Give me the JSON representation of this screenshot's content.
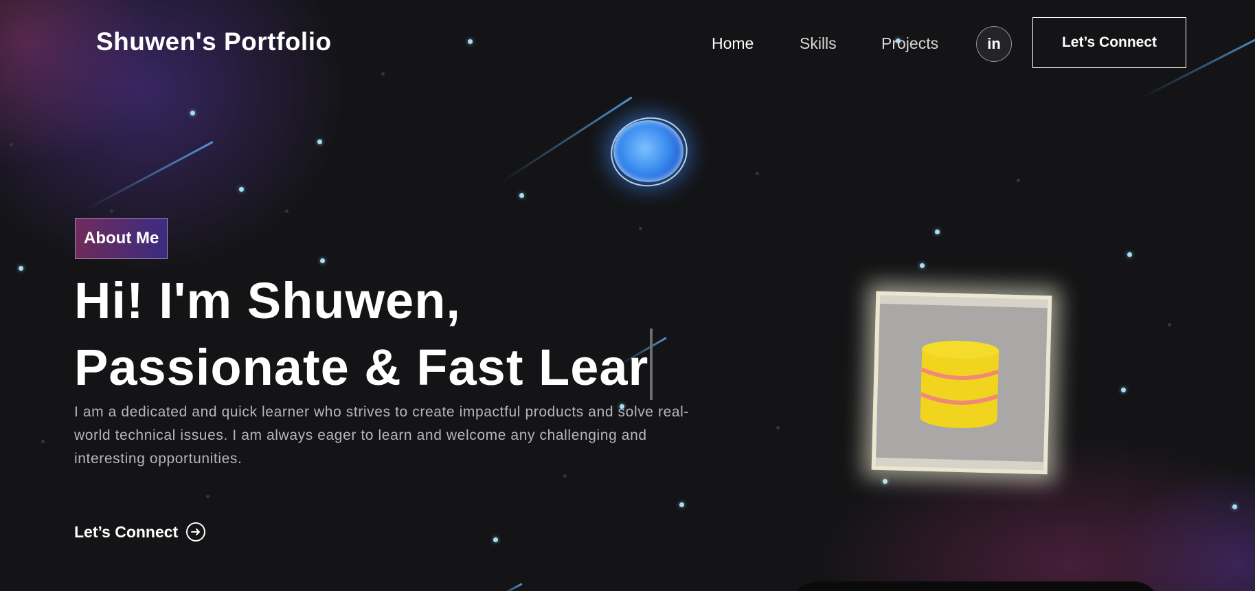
{
  "nav": {
    "logo": "Shuwen's Portfolio",
    "links": [
      "Home",
      "Skills",
      "Projects"
    ],
    "social_icon": "linkedin-icon",
    "social_label": "in",
    "connect_label": "Let’s Connect"
  },
  "hero": {
    "tagline": "About Me",
    "headline_line1": "Hi! I'm Shuwen,",
    "headline_line2": "Passionate & Fast Lear",
    "description": "I am a dedicated and quick learner who strives to create impactful products and solve real-world technical issues. I am always eager to learn and welcome any challenging and interesting opportunities.",
    "cta_label": "Let’s Connect",
    "cta_icon": "arrow-right-circle-icon"
  },
  "decor": {
    "planet_icon": "planet-icon",
    "card_icon": "database-icon",
    "accent": "#4a8cf5",
    "card_database_color": "#f0d41e",
    "card_band_color": "#f08a74"
  }
}
